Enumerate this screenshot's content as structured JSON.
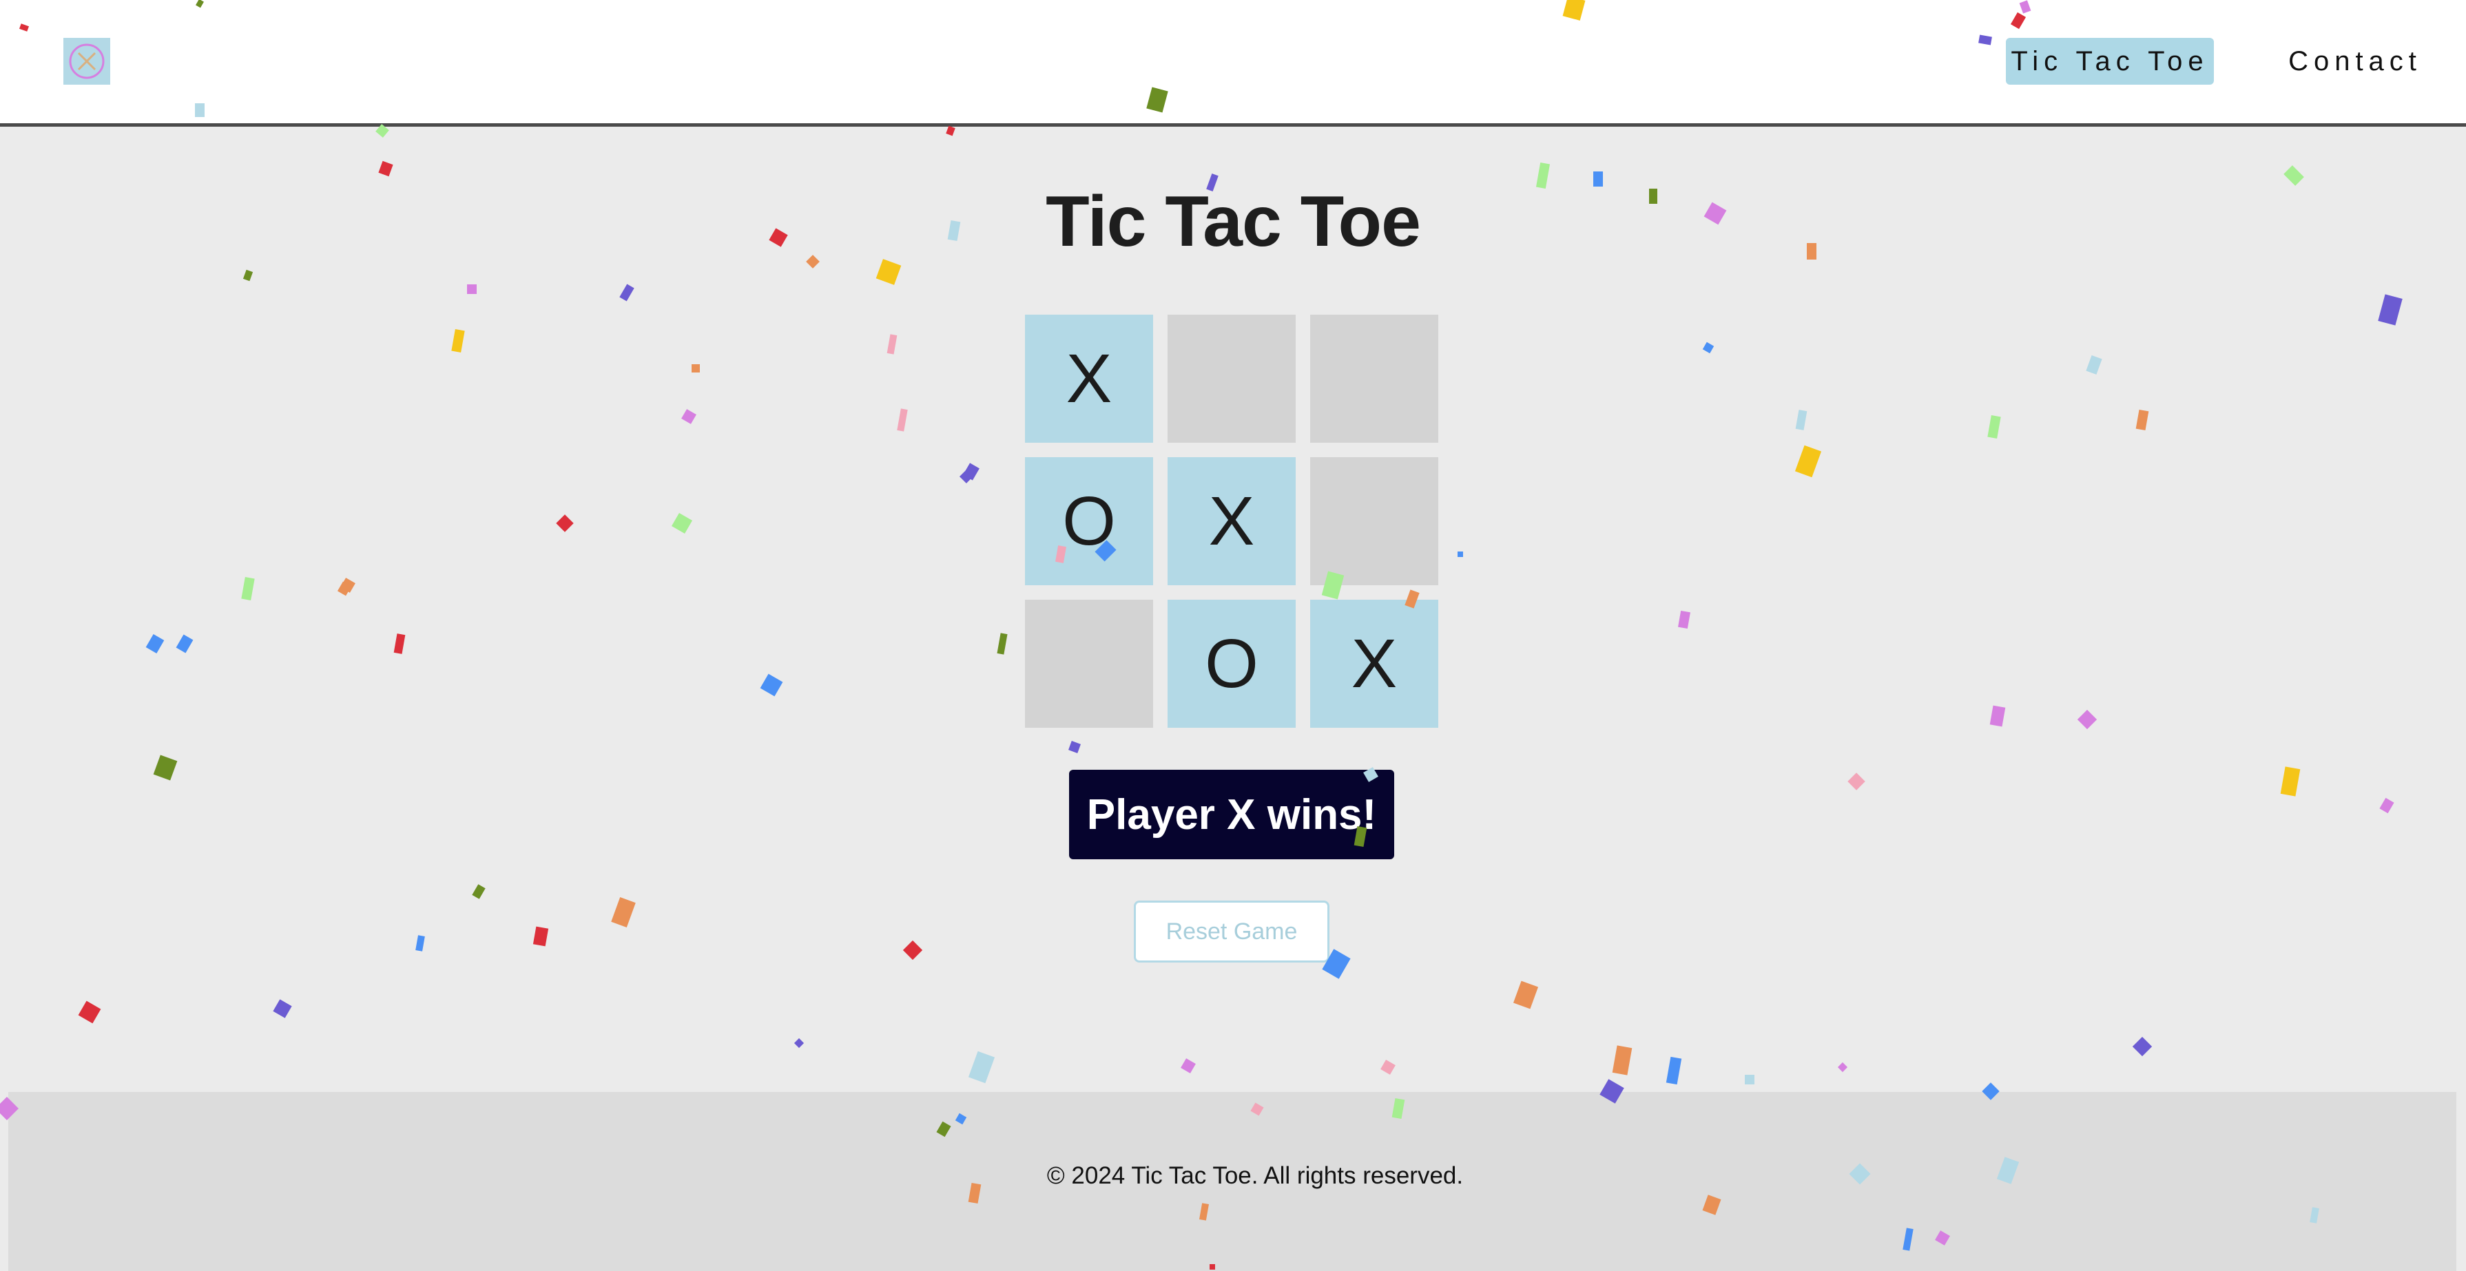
{
  "header": {
    "logo_icon": "tic-tac-toe-logo-icon",
    "nav": [
      {
        "label": "Tic Tac Toe",
        "active": true
      },
      {
        "label": "Contact",
        "active": false
      }
    ]
  },
  "main": {
    "title": "Tic Tac Toe",
    "board": [
      [
        "X",
        "",
        ""
      ],
      [
        "O",
        "X",
        ""
      ],
      [
        "",
        "O",
        "X"
      ]
    ],
    "status": "Player X wins!",
    "reset_label": "Reset Game"
  },
  "footer": {
    "text": "© 2024 Tic Tac Toe. All rights reserved."
  },
  "colors": {
    "filled_cell": "#b3d9e6",
    "empty_cell": "#d3d3d3",
    "status_bg": "#06042e",
    "nav_active_bg": "#add8e6"
  },
  "decorations": {
    "confetti_icon": "confetti-icon",
    "confetti_colors": [
      "#dc2f3a",
      "#4a90f5",
      "#f5c518",
      "#a5ee90",
      "#6b5bd2",
      "#d67fe0",
      "#6b8e23",
      "#e99055",
      "#b3d9e6",
      "#f2a5b8"
    ]
  }
}
